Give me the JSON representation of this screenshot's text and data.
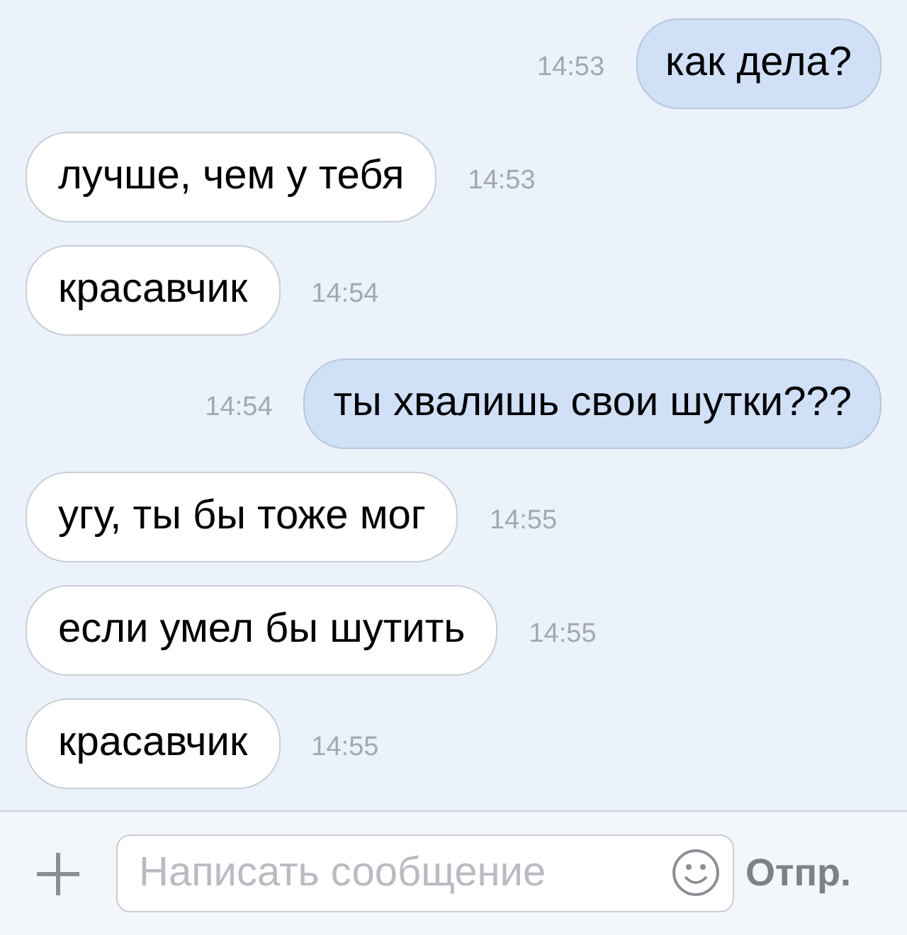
{
  "messages": [
    {
      "kind": "outgoing",
      "text": "как дела?",
      "time": "14:53"
    },
    {
      "kind": "incoming",
      "text": "лучше, чем у тебя",
      "time": "14:53"
    },
    {
      "kind": "incoming",
      "text": "красавчик",
      "time": "14:54"
    },
    {
      "kind": "outgoing",
      "text": "ты хвалишь свои шутки???",
      "time": "14:54"
    },
    {
      "kind": "incoming",
      "text": "угу, ты бы тоже мог",
      "time": "14:55"
    },
    {
      "kind": "incoming",
      "text": "если умел бы шутить",
      "time": "14:55"
    },
    {
      "kind": "incoming",
      "text": "красавчик",
      "time": "14:55"
    }
  ],
  "composer": {
    "placeholder": "Написать сообщение",
    "send_label": "Отпр."
  }
}
